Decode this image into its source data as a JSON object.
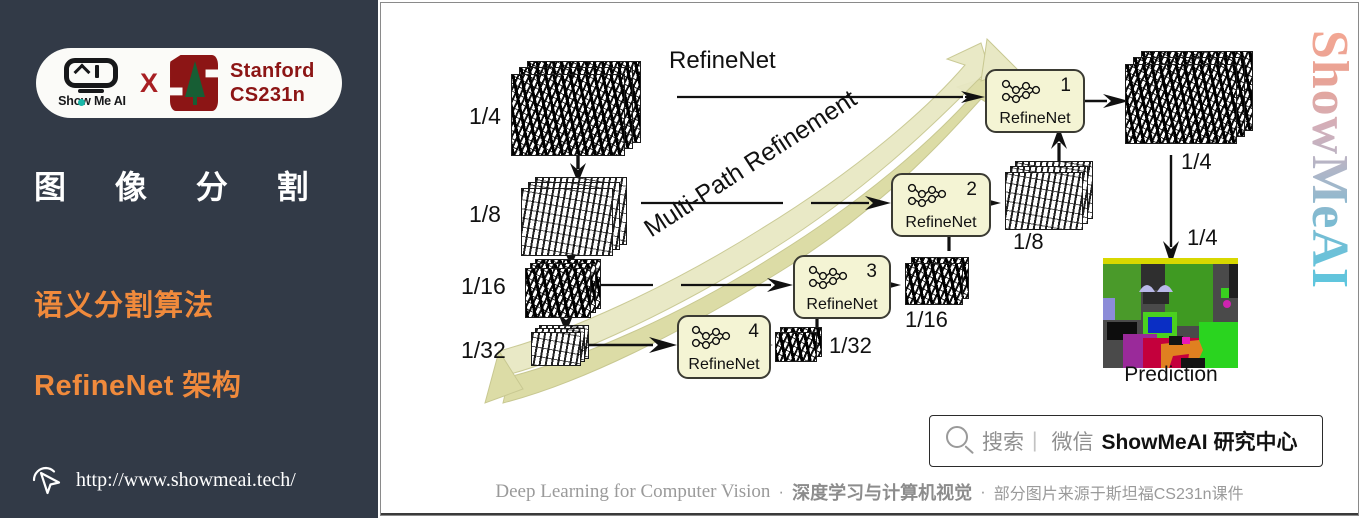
{
  "left_panel": {
    "brand_logo": {
      "name": "show-me-ai",
      "wordmark": "Show Me AI"
    },
    "cross": "X",
    "partner": {
      "line1": "Stanford",
      "line2": "CS231n"
    },
    "topic_title": "图 像 分 割",
    "subtitle_1": "语义分割算法",
    "subtitle_2": "RefineNet 架构",
    "url": "http://www.showmeai.tech/",
    "colors": {
      "background": "#323a47",
      "accent": "#f08a3c",
      "stanford_red": "#8c1515"
    }
  },
  "diagram": {
    "title": "RefineNet",
    "banner_label": "Multi-Path Refinement",
    "scale_labels_left": [
      "1/4",
      "1/8",
      "1/16",
      "1/32"
    ],
    "refinenet_blocks": [
      {
        "index": "1",
        "label": "RefineNet"
      },
      {
        "index": "2",
        "label": "RefineNet"
      },
      {
        "index": "3",
        "label": "RefineNet"
      },
      {
        "index": "4",
        "label": "RefineNet"
      }
    ],
    "output_scale_labels": [
      "1/32",
      "1/16",
      "1/8",
      "1/4"
    ],
    "final_upsample_label": "1/4",
    "prediction_caption": "Prediction",
    "colors": {
      "block_fill": "#f4f4d4",
      "block_border": "#3b3b33",
      "banner_fill": "#dcdca6"
    }
  },
  "search_bar": {
    "icon": "search-icon",
    "placeholder_text": "搜索",
    "divider": "|",
    "channel_label": "微信",
    "account_name": "ShowMeAI 研究中心"
  },
  "footer": {
    "english": "Deep Learning for Computer Vision",
    "sep1": "·",
    "chinese_bold": "深度学习与计算机视觉",
    "sep2": "·",
    "chinese_note": "部分图片来源于斯坦福CS231n课件"
  },
  "watermark": {
    "text": "ShowMeAI"
  }
}
